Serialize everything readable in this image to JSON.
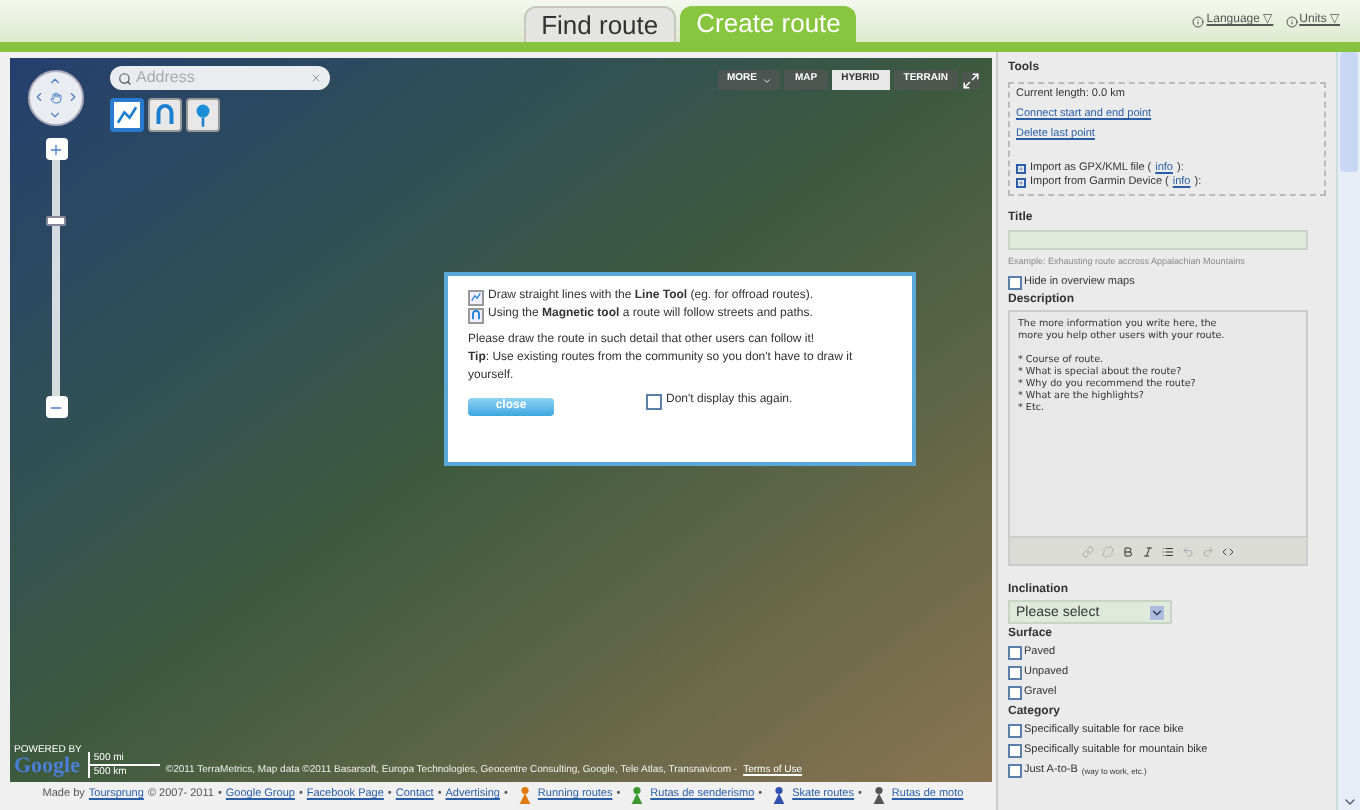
{
  "header": {
    "tabs": [
      {
        "label": "Find route",
        "selected": false
      },
      {
        "label": "Create route",
        "selected": true
      }
    ],
    "links": [
      "Language ▽",
      "Units ▽"
    ]
  },
  "map": {
    "search": {
      "placeholder": "Address"
    },
    "tools": [
      {
        "kind": "line",
        "selected": true
      },
      {
        "kind": "magnet",
        "selected": false
      },
      {
        "kind": "pin",
        "selected": false
      }
    ],
    "zoom": {
      "level": 0.75
    },
    "more_button": "MORE",
    "map_types": [
      {
        "label": "MAP",
        "selected": false
      },
      {
        "label": "HYBRID",
        "selected": true
      },
      {
        "label": "TERRAIN",
        "selected": false
      }
    ],
    "logo": {
      "caption": "POWERED BY",
      "name": "Google"
    },
    "scale": [
      "500 mi",
      "500 km"
    ],
    "attribution": "©2011 TerraMetrics, Map data ©2011 Basarsoft, Europa Technologies, Geocentre Consulting, Google, Tele Atlas, Transnavicom -",
    "terms_link": "Terms of Use"
  },
  "dialog": {
    "hints": [
      {
        "kind": "line",
        "text": "Draw straight lines with the **Line Tool** (eg. for offroad routes)."
      },
      {
        "kind": "magnet",
        "text": "Using the **Magnetic tool** a route will follow streets and paths."
      }
    ],
    "paragraphs": [
      "Please draw the route in such detail that other users can follow it!",
      "**Tip**: Use existing routes from the community so you don't have to draw it yourself."
    ],
    "close_button": "close",
    "dont_show": {
      "label": "Don't display this again.",
      "checked": false
    }
  },
  "sidebar": {
    "tools_heading": "Tools",
    "current_length": "Current length: 0.0 km",
    "actions": [
      "Connect start and end point",
      "Delete last point"
    ],
    "imports": [
      {
        "text": "Import as GPX/KML file (",
        "link": "info",
        "end": "):"
      },
      {
        "text": "Import from Garmin Device (",
        "link": "info",
        "end": "):"
      }
    ],
    "title_label": "Title",
    "title_example": "Example: Exhausting route accross Appalachian Mountains",
    "hide": {
      "label": "Hide in overview maps",
      "checked": false
    },
    "description_label": "Description",
    "description_text": "The more information you write here, the\nmore you help other users with your route.\n\n* Course of route.\n* What is special about the route?\n* Why do you recommend the route?\n* What are the highlights?\n* Etc.",
    "inclination_label": "Inclination",
    "inclination_select": "Please select",
    "surface_label": "Surface",
    "surface": [
      {
        "label": "Paved",
        "checked": false
      },
      {
        "label": "Unpaved",
        "checked": false
      },
      {
        "label": "Gravel",
        "checked": false
      }
    ],
    "category_label": "Category",
    "category": [
      {
        "label": "Specifically suitable for race bike",
        "checked": false
      },
      {
        "label": "Specifically suitable for mountain bike",
        "checked": false
      },
      {
        "label": "Just A-to-B",
        "checked": false,
        "note": "(way to work, etc.)"
      }
    ]
  },
  "footer": {
    "made_by": "Made by",
    "company": "Toursprung",
    "copyright": "© 2007- 2011",
    "separator": "•",
    "links": [
      {
        "label": "Google Group",
        "kind": "plain"
      },
      {
        "label": "Facebook Page",
        "kind": "plain"
      },
      {
        "label": "Contact",
        "kind": "plain"
      },
      {
        "label": "Advertising",
        "kind": "plain"
      },
      {
        "label": "Running routes",
        "kind": "running"
      },
      {
        "label": "Rutas de senderismo",
        "kind": "hiking"
      },
      {
        "label": "Skate routes",
        "kind": "skate"
      },
      {
        "label": "Rutas de moto",
        "kind": "moto"
      }
    ]
  }
}
